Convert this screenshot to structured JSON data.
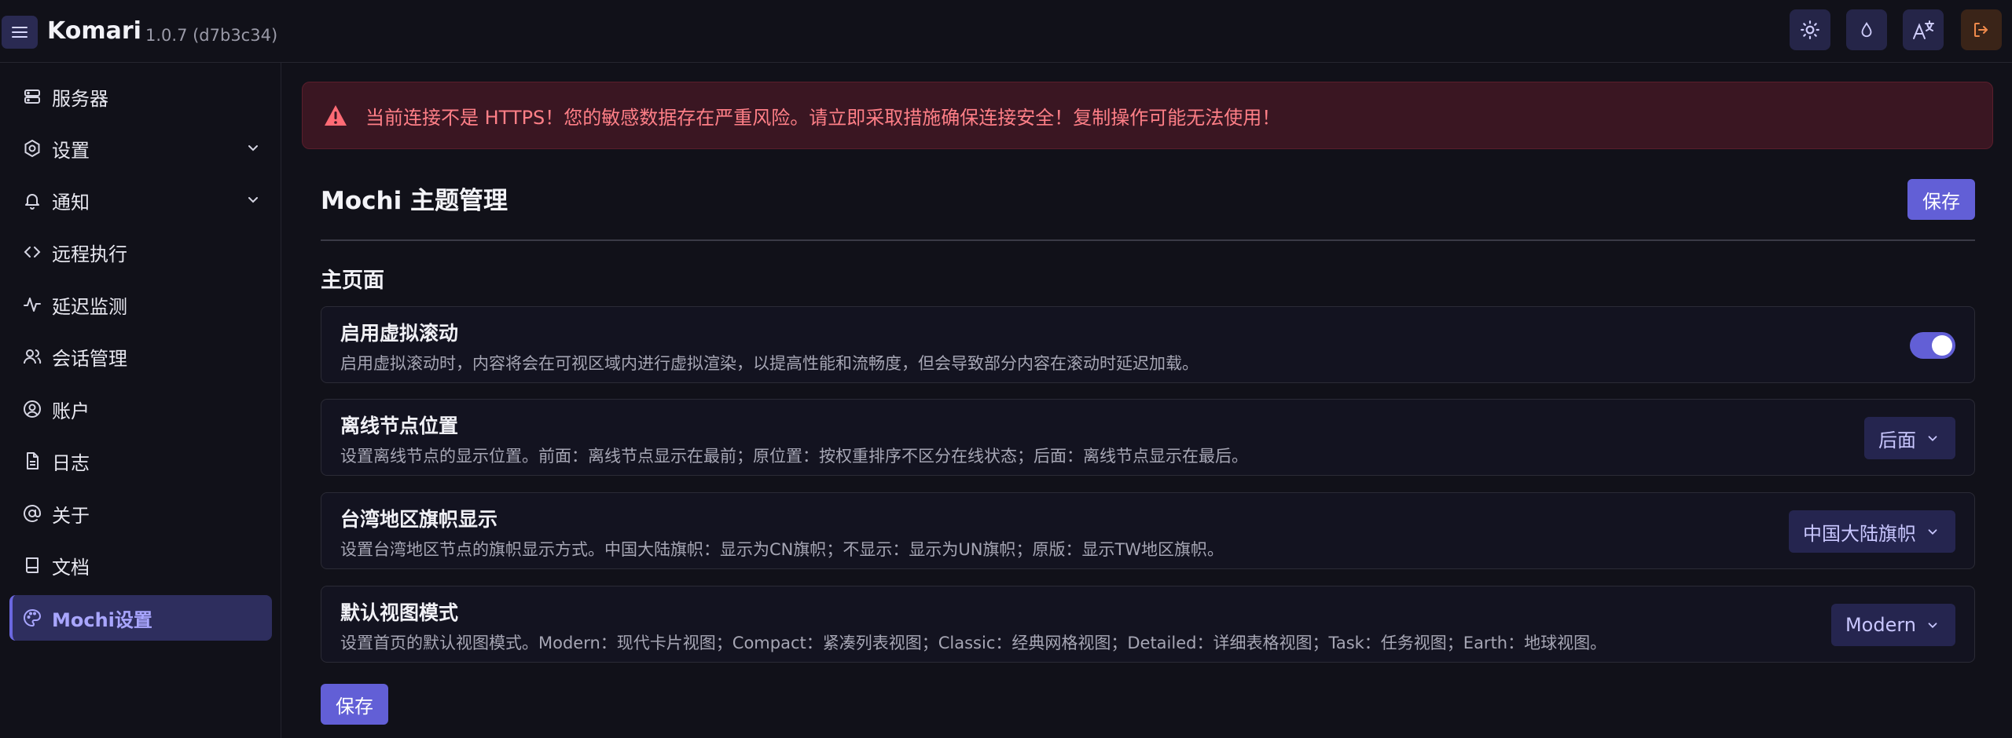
{
  "header": {
    "brand": "Komari",
    "version": "1.0.7 (d7b3c34)",
    "icons": [
      "menu-icon",
      "sun-icon",
      "droplet-icon",
      "translate-icon",
      "logout-icon"
    ]
  },
  "sidebar": {
    "items": [
      {
        "label": "服务器",
        "icon": "server-icon"
      },
      {
        "label": "设置",
        "icon": "settings-icon"
      },
      {
        "label": "通知",
        "icon": "bell-icon"
      },
      {
        "label": "远程执行",
        "icon": "code-icon"
      },
      {
        "label": "延迟监测",
        "icon": "activity-icon"
      },
      {
        "label": "会话管理",
        "icon": "users-icon"
      },
      {
        "label": "账户",
        "icon": "user-circle-icon"
      },
      {
        "label": "日志",
        "icon": "file-icon"
      },
      {
        "label": "关于",
        "icon": "at-icon"
      },
      {
        "label": "文档",
        "icon": "book-icon"
      },
      {
        "label": "Mochi设置",
        "icon": "palette-icon"
      }
    ]
  },
  "alert": {
    "text": "当前连接不是 HTTPS！您的敏感数据存在严重风险。请立即采取措施确保连接安全！复制操作可能无法使用！"
  },
  "main": {
    "title": "Mochi 主题管理",
    "save_label": "保存",
    "section_title": "主页面",
    "settings": [
      {
        "title": "启用虚拟滚动",
        "desc": "启用虚拟滚动时，内容将会在可视区域内进行虚拟渲染，以提高性能和流畅度，但会导致部分内容在滚动时延迟加载。",
        "enabled": true
      },
      {
        "title": "离线节点位置",
        "desc": "设置离线节点的显示位置。前面：离线节点显示在最前；原位置：按权重排序不区分在线状态；后面：离线节点显示在最后。",
        "value": "后面"
      },
      {
        "title": "台湾地区旗帜显示",
        "desc": "设置台湾地区节点的旗帜显示方式。中国大陆旗帜：显示为CN旗帜；不显示：显示为UN旗帜；原版：显示TW地区旗帜。",
        "value": "中国大陆旗帜"
      },
      {
        "title": "默认视图模式",
        "desc": "设置首页的默认视图模式。Modern：现代卡片视图；Compact：紧凑列表视图；Classic：经典网格视图；Detailed：详细表格视图；Task：任务视图；Earth：地球视图。",
        "value": "Modern"
      }
    ]
  },
  "colors": {
    "background": "#111119",
    "accent": "#625fd6",
    "alert_bg": "#3a1622",
    "alert_text": "#ff7f87"
  }
}
